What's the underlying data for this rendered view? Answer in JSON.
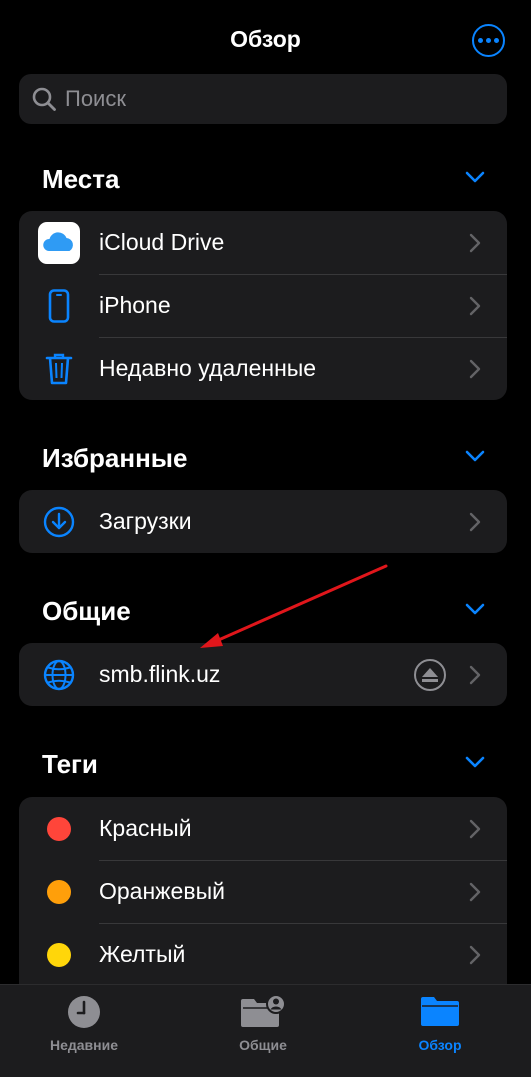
{
  "nav": {
    "title": "Обзор",
    "more_icon": "ellipsis-circle-icon"
  },
  "search": {
    "placeholder": "Поиск",
    "icon": "search-icon"
  },
  "sections": {
    "places": {
      "title": "Места",
      "items": [
        {
          "label": "iCloud Drive",
          "icon": "icloud-icon"
        },
        {
          "label": "iPhone",
          "icon": "iphone-icon"
        },
        {
          "label": "Недавно удаленные",
          "icon": "trash-icon"
        }
      ]
    },
    "favorites": {
      "title": "Избранные",
      "items": [
        {
          "label": "Загрузки",
          "icon": "download-icon"
        }
      ]
    },
    "shared": {
      "title": "Общие",
      "items": [
        {
          "label": "smb.flink.uz",
          "icon": "globe-icon",
          "eject_icon": "eject-icon"
        }
      ]
    },
    "tags": {
      "title": "Теги",
      "items": [
        {
          "label": "Красный",
          "color": "#ff453a"
        },
        {
          "label": "Оранжевый",
          "color": "#ff9f0a"
        },
        {
          "label": "Желтый",
          "color": "#ffd60a"
        }
      ]
    }
  },
  "tabbar": {
    "tabs": [
      {
        "label": "Недавние",
        "icon": "clock-icon",
        "active": false
      },
      {
        "label": "Общие",
        "icon": "shared-folder-icon",
        "active": false
      },
      {
        "label": "Обзор",
        "icon": "folder-icon",
        "active": true
      }
    ]
  },
  "colors": {
    "accent": "#0a84ff",
    "background": "#000000",
    "cell": "#1c1c1e",
    "annotation": "#e0161b"
  }
}
